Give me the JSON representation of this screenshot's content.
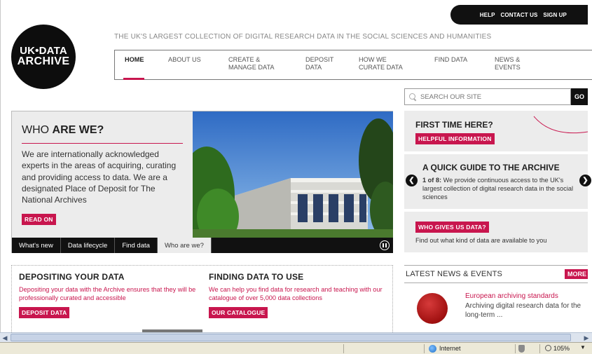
{
  "topbar": {
    "links": [
      "HELP",
      "CONTACT US",
      "SIGN UP"
    ]
  },
  "logo": {
    "line1": "UK•DATA",
    "line2": "ARCHIVE"
  },
  "tagline": "THE UK'S LARGEST COLLECTION OF DIGITAL RESEARCH DATA IN THE SOCIAL SCIENCES AND HUMANITIES",
  "nav": {
    "items": [
      {
        "label": "HOME"
      },
      {
        "label": "ABOUT US"
      },
      {
        "label": "CREATE & MANAGE DATA"
      },
      {
        "label": "DEPOSIT DATA"
      },
      {
        "label": "HOW WE CURATE DATA"
      },
      {
        "label": "FIND DATA"
      },
      {
        "label": "NEWS & EVENTS"
      }
    ]
  },
  "search": {
    "placeholder": "SEARCH OUR SITE",
    "go_label": "GO"
  },
  "hero": {
    "title_plain": "WHO ",
    "title_bold": "ARE WE?",
    "body": "We are internationally acknowledged experts in the areas of acquiring, curating and providing access to data. We are a designated Place of Deposit for The National Archives",
    "read_on": "READ ON",
    "tabs": [
      "What's new",
      "Data lifecycle",
      "Find data",
      "Who are we?"
    ]
  },
  "first_time": {
    "title": "FIRST TIME HERE?",
    "button": "HELPFUL INFORMATION"
  },
  "quick_guide": {
    "title": "A QUICK GUIDE TO THE ARCHIVE",
    "counter": "1 of 8:",
    "text": " We provide continuous access to the UK's largest collection of digital research data in the social sciences"
  },
  "who_gives": {
    "button": "WHO GIVES US DATA?",
    "text": "Find out what kind of data are available to you"
  },
  "depositing": {
    "title": "DEPOSITING YOUR DATA",
    "text": "Depositing your data with the Archive ensures that they will be professionally curated and accessible",
    "button": "DEPOSIT DATA"
  },
  "finding": {
    "title": "FINDING DATA TO USE",
    "text": "We can help you find data for research and teaching with our catalogue of over 5,000 data collections",
    "button": "OUR CATALOGUE"
  },
  "news": {
    "title": "LATEST NEWS & EVENTS",
    "more": "MORE",
    "item_title": "European archiving standards",
    "item_desc": "Archiving digital research data for the long-term ..."
  },
  "statusbar": {
    "zone": "Internet",
    "zoom": "105%"
  },
  "colors": {
    "accent": "#c8164e",
    "dark": "#111111",
    "panel": "#ececec"
  }
}
